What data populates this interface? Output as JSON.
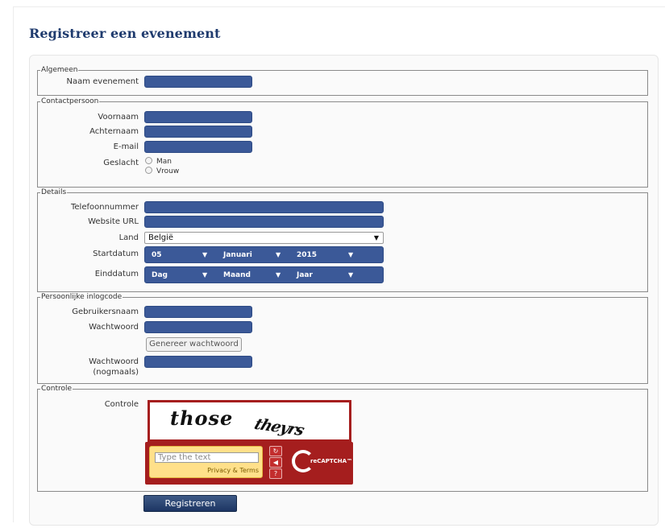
{
  "page": {
    "title": "Registreer een evenement"
  },
  "sections": {
    "general": {
      "legend": "Algemeen",
      "event_name_label": "Naam evenement"
    },
    "contact": {
      "legend": "Contactpersoon",
      "first_name_label": "Voornaam",
      "last_name_label": "Achternaam",
      "email_label": "E-mail",
      "gender_label": "Geslacht",
      "gender_options": [
        "Man",
        "Vrouw"
      ]
    },
    "details": {
      "legend": "Details",
      "phone_label": "Telefoonnummer",
      "website_label": "Website URL",
      "country_label": "Land",
      "country_value": "België",
      "start_date_label": "Startdatum",
      "start_date": {
        "day": "05",
        "month": "Januari",
        "year": "2015"
      },
      "end_date_label": "Einddatum",
      "end_date": {
        "day": "Dag",
        "month": "Maand",
        "year": "Jaar"
      },
      "dropdown_arrow": "▼"
    },
    "login": {
      "legend": "Persoonlijke inlogcode",
      "username_label": "Gebruikersnaam",
      "password_label": "Wachtwoord",
      "generate_button": "Genereer wachtwoord",
      "password_repeat_label_1": "Wachtwoord",
      "password_repeat_label_2": "(nogmaals)"
    },
    "control": {
      "legend": "Controle",
      "captcha_label": "Controle",
      "captcha": {
        "words": [
          "those",
          "theyrs"
        ],
        "placeholder": "Type the text",
        "privacy_link": "Privacy & Terms",
        "logo_text": "reCAPTCHA™",
        "icons": [
          "refresh-icon",
          "audio-icon",
          "help-icon"
        ]
      }
    }
  },
  "submit": {
    "label": "Registreren"
  },
  "colors": {
    "title": "#1f3b6e",
    "input_fill": "#3b5998",
    "captcha_red": "#a51e1e",
    "captcha_yellow": "#ffe08a"
  }
}
